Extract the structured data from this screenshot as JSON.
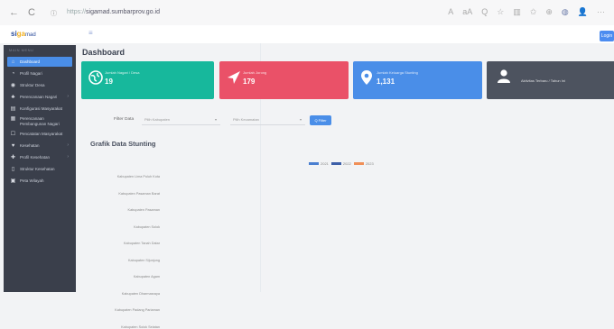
{
  "browser": {
    "url_prefix": "https://",
    "url_host": "sigamad.sumbarprov.go.id",
    "nav_back": "←",
    "nav_reload": "C",
    "toolbar_icons": [
      "A",
      "aA",
      "Q",
      "☆",
      "▥",
      "✩",
      "⊕",
      "◍",
      "👤",
      "···"
    ]
  },
  "app": {
    "logo_prefix": "si",
    "logo_accent": "ga",
    "logo_suffix": "mad",
    "menu_toggle": "≡",
    "login_label": "Login"
  },
  "sidebar": {
    "heading": "MAIN MENU",
    "items": [
      {
        "label": "Dashboard",
        "icon": "⌂",
        "active": true
      },
      {
        "label": "Profil Nagari",
        "icon": "◔",
        "active": false
      },
      {
        "label": "Struktur Desa",
        "icon": "◉",
        "active": false
      },
      {
        "label": "Perencanaan Nagari",
        "icon": "♣",
        "active": false,
        "chevron": "›"
      },
      {
        "label": "Konfigurasi Masyarakat",
        "icon": "▤",
        "active": false
      },
      {
        "label": "Perencanaan Pembangunan Nagari",
        "icon": "▦",
        "active": false
      },
      {
        "label": "Pencatatan Masyarakat",
        "icon": "☐",
        "active": false
      },
      {
        "label": "Kesehatan",
        "icon": "♥",
        "active": false,
        "chevron": "›"
      },
      {
        "label": "Profil Kesehatan",
        "icon": "✚",
        "active": false,
        "chevron": "›"
      },
      {
        "label": "Struktur Kesehatan",
        "icon": "▯",
        "active": false
      },
      {
        "label": "Peta Wilayah",
        "icon": "▣",
        "active": false
      }
    ]
  },
  "main": {
    "title": "Dashboard",
    "cards": [
      {
        "label": "Jumlah Nagari / Desa",
        "value": "19",
        "icon": "globe-icon",
        "color": "#17b89c"
      },
      {
        "label": "Jumlah Jorong",
        "value": "179",
        "icon": "navigation-arrow-icon",
        "color": "#ea5168"
      },
      {
        "label": "Jumlah Keluarga Stunting",
        "value": "1,131",
        "icon": "map-pin-icon",
        "color": "#4a8ee8"
      },
      {
        "label": "Aktivitas Terbaru / Tahun Ini",
        "value": "",
        "icon": "user-icon",
        "color": "#4d535f"
      }
    ],
    "filter": {
      "label": "Filter Data",
      "select1": "Pilih Kabupaten",
      "select2": "Pilih Kecamatan",
      "button": "Q Filter"
    },
    "chart_title": "Grafik Data Stunting"
  },
  "chart_data": {
    "type": "bar",
    "orientation": "horizontal",
    "title": "Grafik Data Stunting",
    "categories": [
      "Kabupaten Lima Puluh Kota",
      "Kabupaten Pasaman Barat",
      "Kabupaten Pasaman",
      "Kabupaten Solok",
      "Kabupaten Tanah Datar",
      "Kabupaten Sijunjung",
      "Kabupaten Agam",
      "Kabupaten Dharmasraya",
      "Kabupaten Padang Pariaman",
      "Kabupaten Solok Selatan"
    ],
    "series": [
      {
        "name": "2021",
        "color": "#4a7fd0",
        "values": [
          0,
          0,
          0,
          0,
          0,
          0,
          0,
          0,
          0,
          0
        ]
      },
      {
        "name": "2022",
        "color": "#3d5fa8",
        "values": [
          0,
          0,
          0,
          0,
          0,
          0,
          0,
          0,
          0,
          0
        ]
      },
      {
        "name": "2023",
        "color": "#f08f58",
        "values": [
          0,
          0,
          0,
          0,
          0,
          0,
          0,
          0,
          0,
          0
        ]
      }
    ],
    "legend_position": "top"
  }
}
